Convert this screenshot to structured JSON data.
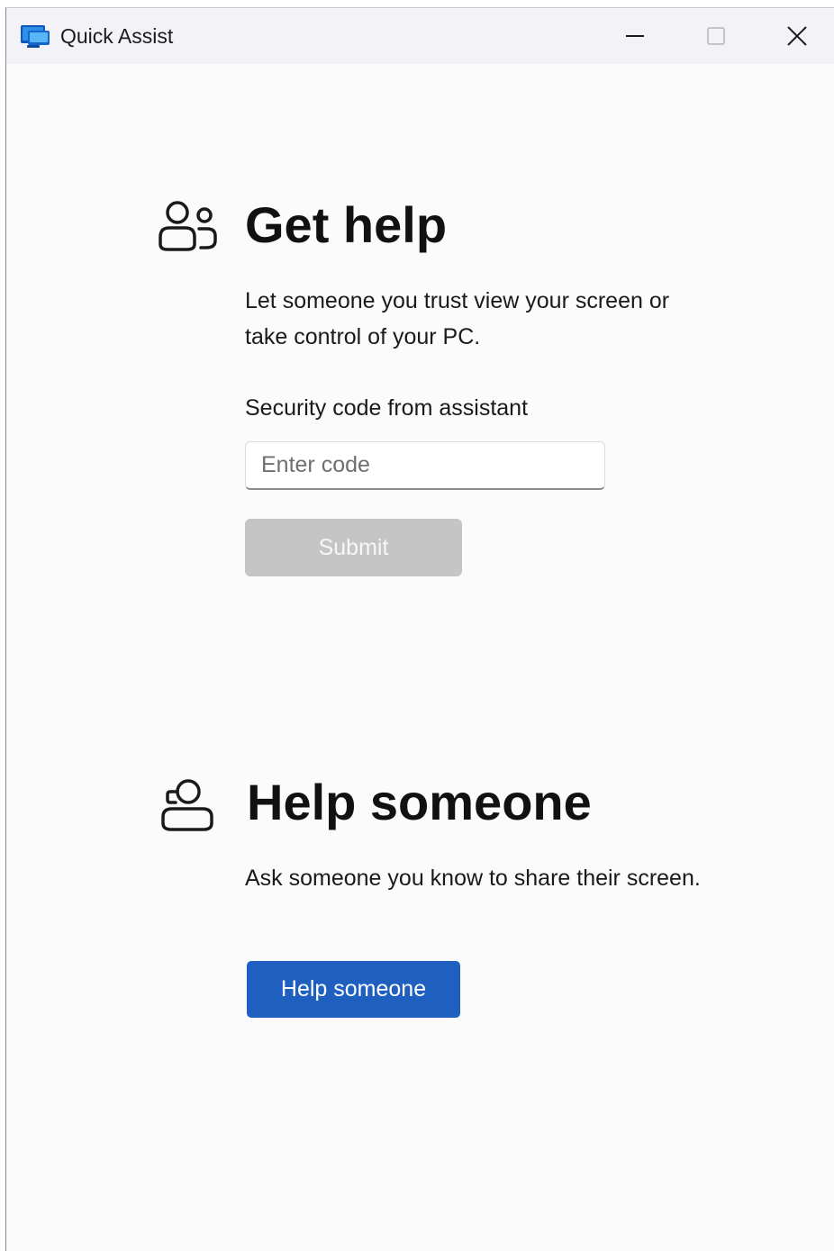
{
  "window": {
    "title": "Quick Assist",
    "controls": {
      "minimize": "minimize",
      "maximize": "maximize",
      "close": "close"
    }
  },
  "get_help": {
    "icon": "people-icon",
    "title": "Get help",
    "description": "Let someone you trust view your screen or take control of your PC.",
    "code_label": "Security code from assistant",
    "code_value": "",
    "code_placeholder": "Enter code",
    "submit_label": "Submit",
    "submit_enabled": false
  },
  "help_someone": {
    "icon": "person-headset-icon",
    "title": "Help someone",
    "description": "Ask someone you know to share their screen.",
    "button_label": "Help someone"
  },
  "colors": {
    "accent": "#1f5fbf",
    "disabled_button": "#c5c5c5",
    "window_background": "#fbfbfb",
    "titlebar_background": "#f3f3f7"
  }
}
